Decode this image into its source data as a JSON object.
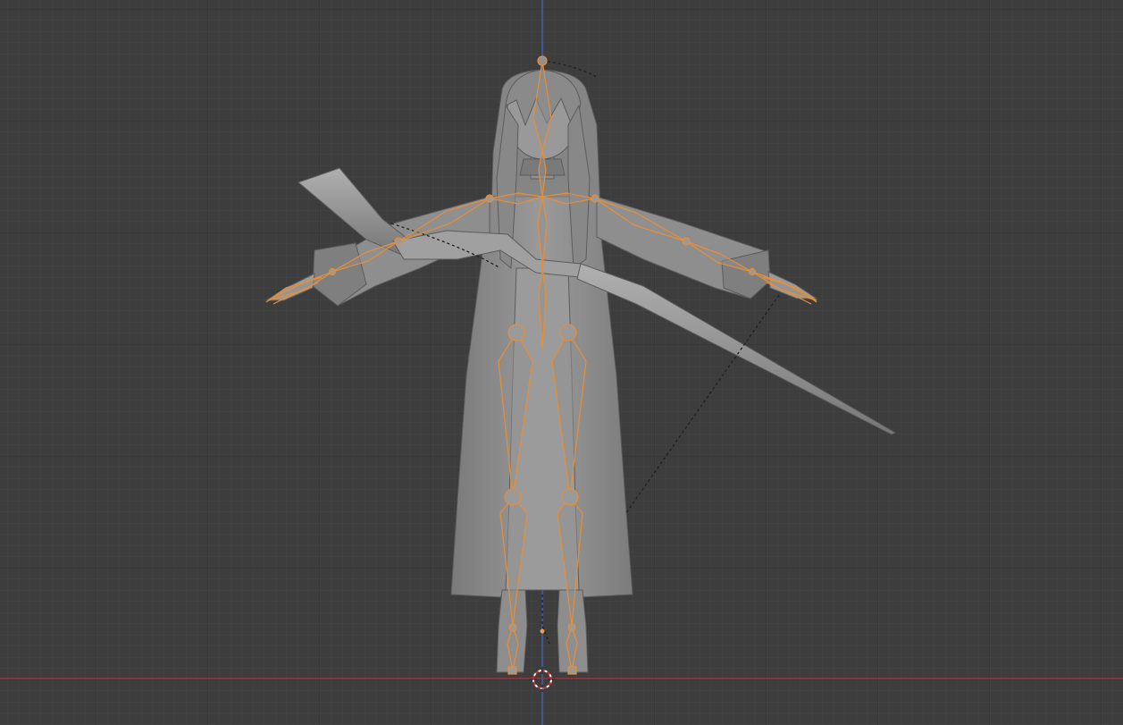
{
  "viewport": {
    "view": "front-orthographic",
    "background_color": "#3d3d3d",
    "grid_minor_color": "#454545",
    "grid_major_color": "#363636",
    "x_axis_color": "#9a3440",
    "z_axis_color": "#3f62a8"
  },
  "scene": {
    "mesh": {
      "name_visible": false,
      "shading": "solid",
      "color": "#8a8a8a"
    },
    "armature": {
      "selected": true,
      "outline_color": "#e88e37",
      "bone_fill_color": "#8f8f8f"
    },
    "relationship_line_color": "#1e1e1e",
    "cursor_icon": "3d-cursor-icon",
    "origin_icon": "origin-dot-icon"
  }
}
